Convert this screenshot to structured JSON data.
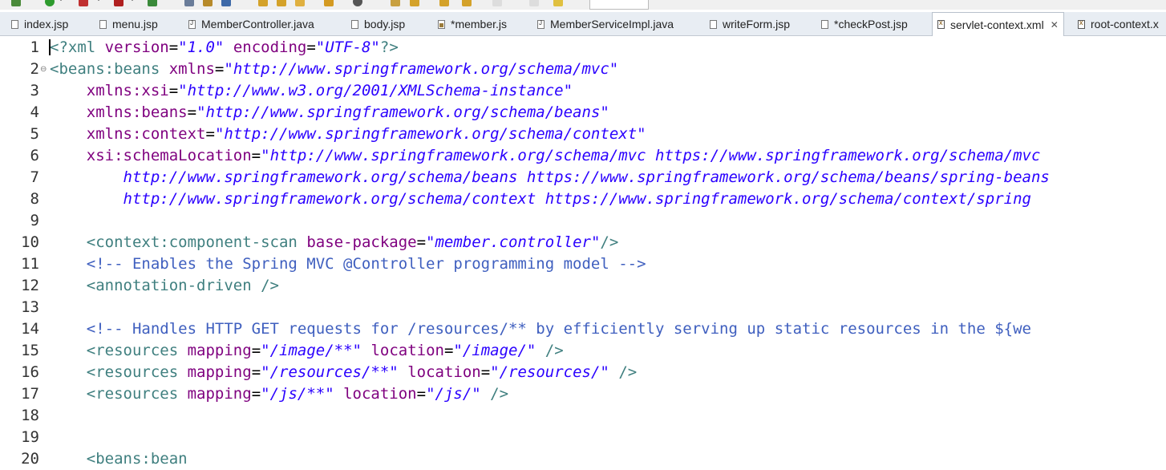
{
  "tabs": [
    {
      "label": "index.jsp",
      "icon": "jsp-file-icon"
    },
    {
      "label": "menu.jsp",
      "icon": "jsp-file-icon"
    },
    {
      "label": "MemberController.java",
      "icon": "java-file-icon"
    },
    {
      "label": "body.jsp",
      "icon": "jsp-file-icon"
    },
    {
      "label": "*member.js",
      "icon": "js-file-icon"
    },
    {
      "label": "MemberServiceImpl.java",
      "icon": "java-file-icon"
    },
    {
      "label": "writeForm.jsp",
      "icon": "jsp-file-icon"
    },
    {
      "label": "*checkPost.jsp",
      "icon": "jsp-file-icon"
    },
    {
      "label": "servlet-context.xml",
      "icon": "xml-file-icon",
      "close": "✕"
    },
    {
      "label": "root-context.x",
      "icon": "xml-file-icon"
    }
  ],
  "editor": {
    "line_numbers": [
      "1",
      "2",
      "3",
      "4",
      "5",
      "6",
      "7",
      "8",
      "9",
      "10",
      "11",
      "12",
      "13",
      "14",
      "15",
      "16",
      "17",
      "18",
      "19",
      "20"
    ],
    "fold_marker": "⊖",
    "lines": [
      {
        "t": [
          [
            "decl",
            "<?xml "
          ],
          [
            "attr",
            "version"
          ],
          [
            "pun",
            "="
          ],
          [
            "val",
            "\"1.0\""
          ],
          [
            "pun",
            " "
          ],
          [
            "attr",
            "encoding"
          ],
          [
            "pun",
            "="
          ],
          [
            "val",
            "\"UTF-8\""
          ],
          [
            "decl",
            "?>"
          ]
        ]
      },
      {
        "t": [
          [
            "tag",
            "<beans:beans "
          ],
          [
            "attr",
            "xmlns"
          ],
          [
            "pun",
            "="
          ],
          [
            "val",
            "\"http://www.springframework.org/schema/mvc\""
          ]
        ]
      },
      {
        "t": [
          [
            "pun",
            "    "
          ],
          [
            "attr",
            "xmlns:xsi"
          ],
          [
            "pun",
            "="
          ],
          [
            "val",
            "\"http://www.w3.org/2001/XMLSchema-instance\""
          ]
        ]
      },
      {
        "t": [
          [
            "pun",
            "    "
          ],
          [
            "attr",
            "xmlns:beans"
          ],
          [
            "pun",
            "="
          ],
          [
            "val",
            "\"http://www.springframework.org/schema/beans\""
          ]
        ]
      },
      {
        "t": [
          [
            "pun",
            "    "
          ],
          [
            "attr",
            "xmlns:context"
          ],
          [
            "pun",
            "="
          ],
          [
            "val",
            "\"http://www.springframework.org/schema/context\""
          ]
        ]
      },
      {
        "t": [
          [
            "pun",
            "    "
          ],
          [
            "attr",
            "xsi:schemaLocation"
          ],
          [
            "pun",
            "="
          ],
          [
            "val",
            "\"http://www.springframework.org/schema/mvc https://www.springframework.org/schema/mvc"
          ]
        ]
      },
      {
        "t": [
          [
            "val",
            "        http://www.springframework.org/schema/beans https://www.springframework.org/schema/beans/spring-beans"
          ]
        ]
      },
      {
        "t": [
          [
            "val",
            "        http://www.springframework.org/schema/context https://www.springframework.org/schema/context/spring"
          ]
        ]
      },
      {
        "t": [
          [
            "pun",
            ""
          ]
        ]
      },
      {
        "t": [
          [
            "pun",
            "    "
          ],
          [
            "tag",
            "<context:component-scan "
          ],
          [
            "attr",
            "base-package"
          ],
          [
            "pun",
            "="
          ],
          [
            "val",
            "\"member.controller\""
          ],
          [
            "tag",
            "/>"
          ]
        ]
      },
      {
        "t": [
          [
            "pun",
            "    "
          ],
          [
            "com",
            "<!-- Enables the Spring MVC @Controller programming model -->"
          ]
        ]
      },
      {
        "t": [
          [
            "pun",
            "    "
          ],
          [
            "tag",
            "<annotation-driven />"
          ]
        ]
      },
      {
        "t": [
          [
            "pun",
            ""
          ]
        ]
      },
      {
        "t": [
          [
            "pun",
            "    "
          ],
          [
            "com",
            "<!-- Handles HTTP GET requests for /resources/** by efficiently serving up static resources in the ${we"
          ]
        ]
      },
      {
        "t": [
          [
            "pun",
            "    "
          ],
          [
            "tag",
            "<resources "
          ],
          [
            "attr",
            "mapping"
          ],
          [
            "pun",
            "="
          ],
          [
            "val",
            "\"/image/**\""
          ],
          [
            "pun",
            " "
          ],
          [
            "attr",
            "location"
          ],
          [
            "pun",
            "="
          ],
          [
            "val",
            "\"/image/\""
          ],
          [
            "tag",
            " />"
          ]
        ]
      },
      {
        "t": [
          [
            "pun",
            "    "
          ],
          [
            "tag",
            "<resources "
          ],
          [
            "attr",
            "mapping"
          ],
          [
            "pun",
            "="
          ],
          [
            "val",
            "\"/resources/**\""
          ],
          [
            "pun",
            " "
          ],
          [
            "attr",
            "location"
          ],
          [
            "pun",
            "="
          ],
          [
            "val",
            "\"/resources/\""
          ],
          [
            "tag",
            " />"
          ]
        ]
      },
      {
        "t": [
          [
            "pun",
            "    "
          ],
          [
            "tag",
            "<resources "
          ],
          [
            "attr",
            "mapping"
          ],
          [
            "pun",
            "="
          ],
          [
            "val",
            "\"/js/**\""
          ],
          [
            "pun",
            " "
          ],
          [
            "attr",
            "location"
          ],
          [
            "pun",
            "="
          ],
          [
            "val",
            "\"/js/\""
          ],
          [
            "tag",
            " />"
          ]
        ]
      },
      {
        "t": [
          [
            "pun",
            ""
          ]
        ]
      },
      {
        "t": [
          [
            "pun",
            ""
          ]
        ]
      },
      {
        "t": [
          [
            "pun",
            "    "
          ],
          [
            "tag",
            "<beans:bean"
          ]
        ]
      }
    ]
  }
}
